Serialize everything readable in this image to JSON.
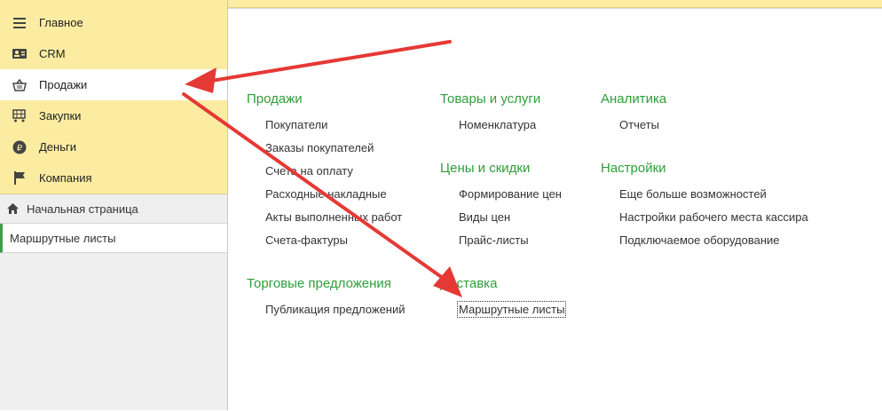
{
  "sidebar": {
    "sections": [
      {
        "label": "Главное",
        "icon": "menu-icon"
      },
      {
        "label": "CRM",
        "icon": "id-card-icon"
      },
      {
        "label": "Продажи",
        "icon": "basket-icon"
      },
      {
        "label": "Закупки",
        "icon": "cart-icon"
      },
      {
        "label": "Деньги",
        "icon": "ruble-coin-icon"
      },
      {
        "label": "Компания",
        "icon": "flag-icon"
      }
    ],
    "active_section": "Продажи",
    "home_label": "Начальная страница",
    "open_window_label": "Маршрутные листы"
  },
  "groups": [
    {
      "title": "Продажи",
      "links": [
        "Покупатели",
        "Заказы покупателей",
        "Счета на оплату",
        "Расходные накладные",
        "Акты выполненных работ",
        "Счета-фактуры"
      ]
    },
    {
      "title": "Торговые предложения",
      "links": [
        "Публикация предложений"
      ]
    },
    {
      "title": "Товары и услуги",
      "links": [
        "Номенклатура"
      ]
    },
    {
      "title": "Цены и скидки",
      "links": [
        "Формирование цен",
        "Виды цен",
        "Прайс-листы"
      ]
    },
    {
      "title": "Доставка",
      "links": [
        "Маршрутные листы"
      ]
    },
    {
      "title": "Аналитика",
      "links": [
        "Отчеты"
      ]
    },
    {
      "title": "Настройки",
      "links": [
        "Еще больше возможностей",
        "Настройки рабочего места кассира",
        "Подключаемое оборудование"
      ]
    }
  ],
  "colors": {
    "section_bg": "#fbeca2",
    "accent_green": "#2f9e3a",
    "arrow_red": "#e53935"
  }
}
